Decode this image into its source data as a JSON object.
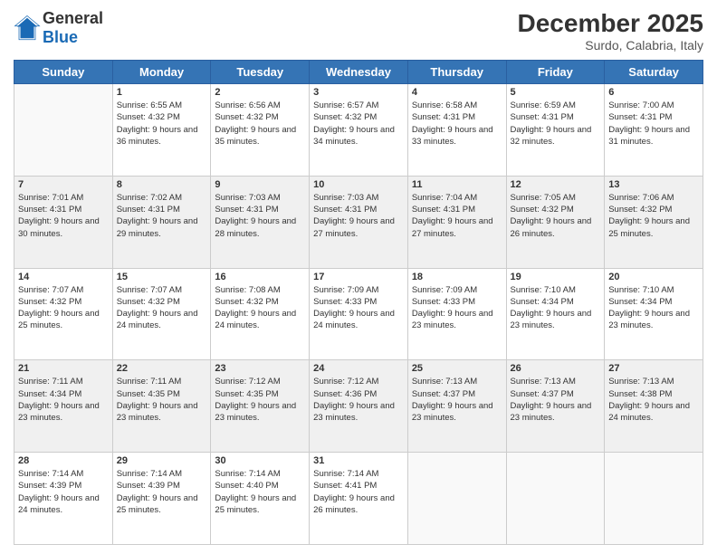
{
  "logo": {
    "general": "General",
    "blue": "Blue"
  },
  "header": {
    "month_title": "December 2025",
    "subtitle": "Surdo, Calabria, Italy"
  },
  "days_of_week": [
    "Sunday",
    "Monday",
    "Tuesday",
    "Wednesday",
    "Thursday",
    "Friday",
    "Saturday"
  ],
  "weeks": [
    [
      {
        "day": "",
        "info": ""
      },
      {
        "day": "1",
        "sunrise": "Sunrise: 6:55 AM",
        "sunset": "Sunset: 4:32 PM",
        "daylight": "Daylight: 9 hours and 36 minutes."
      },
      {
        "day": "2",
        "sunrise": "Sunrise: 6:56 AM",
        "sunset": "Sunset: 4:32 PM",
        "daylight": "Daylight: 9 hours and 35 minutes."
      },
      {
        "day": "3",
        "sunrise": "Sunrise: 6:57 AM",
        "sunset": "Sunset: 4:32 PM",
        "daylight": "Daylight: 9 hours and 34 minutes."
      },
      {
        "day": "4",
        "sunrise": "Sunrise: 6:58 AM",
        "sunset": "Sunset: 4:31 PM",
        "daylight": "Daylight: 9 hours and 33 minutes."
      },
      {
        "day": "5",
        "sunrise": "Sunrise: 6:59 AM",
        "sunset": "Sunset: 4:31 PM",
        "daylight": "Daylight: 9 hours and 32 minutes."
      },
      {
        "day": "6",
        "sunrise": "Sunrise: 7:00 AM",
        "sunset": "Sunset: 4:31 PM",
        "daylight": "Daylight: 9 hours and 31 minutes."
      }
    ],
    [
      {
        "day": "7",
        "sunrise": "Sunrise: 7:01 AM",
        "sunset": "Sunset: 4:31 PM",
        "daylight": "Daylight: 9 hours and 30 minutes."
      },
      {
        "day": "8",
        "sunrise": "Sunrise: 7:02 AM",
        "sunset": "Sunset: 4:31 PM",
        "daylight": "Daylight: 9 hours and 29 minutes."
      },
      {
        "day": "9",
        "sunrise": "Sunrise: 7:03 AM",
        "sunset": "Sunset: 4:31 PM",
        "daylight": "Daylight: 9 hours and 28 minutes."
      },
      {
        "day": "10",
        "sunrise": "Sunrise: 7:03 AM",
        "sunset": "Sunset: 4:31 PM",
        "daylight": "Daylight: 9 hours and 27 minutes."
      },
      {
        "day": "11",
        "sunrise": "Sunrise: 7:04 AM",
        "sunset": "Sunset: 4:31 PM",
        "daylight": "Daylight: 9 hours and 27 minutes."
      },
      {
        "day": "12",
        "sunrise": "Sunrise: 7:05 AM",
        "sunset": "Sunset: 4:32 PM",
        "daylight": "Daylight: 9 hours and 26 minutes."
      },
      {
        "day": "13",
        "sunrise": "Sunrise: 7:06 AM",
        "sunset": "Sunset: 4:32 PM",
        "daylight": "Daylight: 9 hours and 25 minutes."
      }
    ],
    [
      {
        "day": "14",
        "sunrise": "Sunrise: 7:07 AM",
        "sunset": "Sunset: 4:32 PM",
        "daylight": "Daylight: 9 hours and 25 minutes."
      },
      {
        "day": "15",
        "sunrise": "Sunrise: 7:07 AM",
        "sunset": "Sunset: 4:32 PM",
        "daylight": "Daylight: 9 hours and 24 minutes."
      },
      {
        "day": "16",
        "sunrise": "Sunrise: 7:08 AM",
        "sunset": "Sunset: 4:32 PM",
        "daylight": "Daylight: 9 hours and 24 minutes."
      },
      {
        "day": "17",
        "sunrise": "Sunrise: 7:09 AM",
        "sunset": "Sunset: 4:33 PM",
        "daylight": "Daylight: 9 hours and 24 minutes."
      },
      {
        "day": "18",
        "sunrise": "Sunrise: 7:09 AM",
        "sunset": "Sunset: 4:33 PM",
        "daylight": "Daylight: 9 hours and 23 minutes."
      },
      {
        "day": "19",
        "sunrise": "Sunrise: 7:10 AM",
        "sunset": "Sunset: 4:34 PM",
        "daylight": "Daylight: 9 hours and 23 minutes."
      },
      {
        "day": "20",
        "sunrise": "Sunrise: 7:10 AM",
        "sunset": "Sunset: 4:34 PM",
        "daylight": "Daylight: 9 hours and 23 minutes."
      }
    ],
    [
      {
        "day": "21",
        "sunrise": "Sunrise: 7:11 AM",
        "sunset": "Sunset: 4:34 PM",
        "daylight": "Daylight: 9 hours and 23 minutes."
      },
      {
        "day": "22",
        "sunrise": "Sunrise: 7:11 AM",
        "sunset": "Sunset: 4:35 PM",
        "daylight": "Daylight: 9 hours and 23 minutes."
      },
      {
        "day": "23",
        "sunrise": "Sunrise: 7:12 AM",
        "sunset": "Sunset: 4:35 PM",
        "daylight": "Daylight: 9 hours and 23 minutes."
      },
      {
        "day": "24",
        "sunrise": "Sunrise: 7:12 AM",
        "sunset": "Sunset: 4:36 PM",
        "daylight": "Daylight: 9 hours and 23 minutes."
      },
      {
        "day": "25",
        "sunrise": "Sunrise: 7:13 AM",
        "sunset": "Sunset: 4:37 PM",
        "daylight": "Daylight: 9 hours and 23 minutes."
      },
      {
        "day": "26",
        "sunrise": "Sunrise: 7:13 AM",
        "sunset": "Sunset: 4:37 PM",
        "daylight": "Daylight: 9 hours and 23 minutes."
      },
      {
        "day": "27",
        "sunrise": "Sunrise: 7:13 AM",
        "sunset": "Sunset: 4:38 PM",
        "daylight": "Daylight: 9 hours and 24 minutes."
      }
    ],
    [
      {
        "day": "28",
        "sunrise": "Sunrise: 7:14 AM",
        "sunset": "Sunset: 4:39 PM",
        "daylight": "Daylight: 9 hours and 24 minutes."
      },
      {
        "day": "29",
        "sunrise": "Sunrise: 7:14 AM",
        "sunset": "Sunset: 4:39 PM",
        "daylight": "Daylight: 9 hours and 25 minutes."
      },
      {
        "day": "30",
        "sunrise": "Sunrise: 7:14 AM",
        "sunset": "Sunset: 4:40 PM",
        "daylight": "Daylight: 9 hours and 25 minutes."
      },
      {
        "day": "31",
        "sunrise": "Sunrise: 7:14 AM",
        "sunset": "Sunset: 4:41 PM",
        "daylight": "Daylight: 9 hours and 26 minutes."
      },
      {
        "day": "",
        "info": ""
      },
      {
        "day": "",
        "info": ""
      },
      {
        "day": "",
        "info": ""
      }
    ]
  ]
}
